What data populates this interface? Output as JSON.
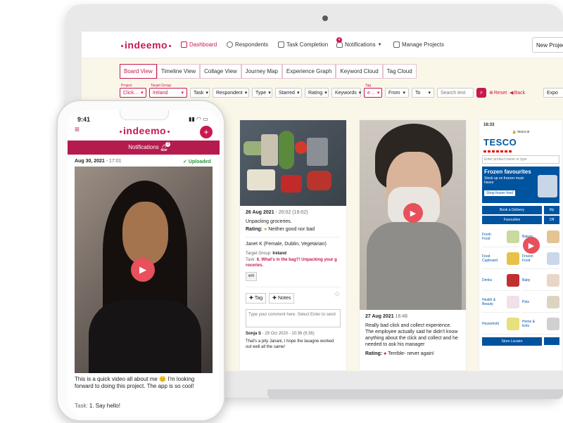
{
  "brand": {
    "name": "indeemo",
    "color": "#c8184f",
    "accent": "#e8505b"
  },
  "nav": {
    "dashboard": "Dashboard",
    "respondents": "Respondents",
    "task_completion": "Task Completion",
    "notifications": "Notifications",
    "notif_count": "4",
    "manage_projects": "Manage Projects",
    "new_project": "New Projec"
  },
  "views": [
    "Board View",
    "Timeline View",
    "Collage View",
    "Journey Map",
    "Experience Graph",
    "Keyword Cloud",
    "Tag Cloud"
  ],
  "filters": {
    "project_label": "Project",
    "project_value": "Click…",
    "target_label": "Target Group",
    "target_value": "Ireland",
    "task": "Task",
    "respondent": "Respondent",
    "type": "Type",
    "starred": "Starred",
    "rating": "Rating",
    "keywords": "Keywords",
    "tag_label": "Tag",
    "tag_value": "e…",
    "from": "From",
    "to": "To",
    "search_placeholder": "Search text",
    "reset": "Reset",
    "back": "Back",
    "export": "Expo"
  },
  "card1": {
    "date": "26 Aug 2021",
    "time": " - 20:02 (19:02)",
    "desc": "Unpacking groceries.",
    "rating_label": "Rating:",
    "rating_value": "Neither good nor bad",
    "person": "Janet K (Female, Dublin, Vegetarian)",
    "target_label": "Target Group:",
    "target_value": "Ireland",
    "task_label": "Task:",
    "task_value": "6. What's in the bag?! Unpacking your g roceries.",
    "chip": "em",
    "tag_btn": "Tag",
    "notes_btn": "Notes",
    "comment_placeholder": "Type your comment here. Select Enter to send",
    "comment_author": "Sonja S",
    "comment_time": " - 29 Oct 2020 - 10:36 (9:36)",
    "comment_text": "That's a pity Janani, I hope the lasagne worked out well all the same!"
  },
  "card2": {
    "date": "27 Aug 2021",
    "time": " 16:48",
    "desc": "Really bad click and collect experience. The employee actually said he didn't know anything about the click and collect and he needed to ask his manager",
    "rating_label": "Rating:",
    "rating_value": "Terrible- never again!"
  },
  "card3": {
    "time": "16:33",
    "url": "tesco.ie",
    "logo": "TESCO",
    "search_placeholder": "Enter product name or type",
    "banner_title": "Frozen favourites",
    "banner_sub": "Stock up on freezer must-haves",
    "banner_btn": "Shop frozen food",
    "btn_delivery": "Book a Delivery",
    "btn_my": "My",
    "btn_favourites": "Favourites",
    "btn_off": "Off",
    "categories": [
      "Fresh Food",
      "Bakery",
      "Food Cupboard",
      "Frozen Food",
      "Drinks",
      "Baby",
      "Health & Beauty",
      "Pets",
      "Household",
      "Home & Ents"
    ],
    "store_locator": "Store Locator"
  },
  "phone": {
    "time": "9:41",
    "header_title": "Notifications",
    "badge": "3",
    "post_date": "Aug 30, 2021",
    "post_time": " - 17:01",
    "status": "Uploaded",
    "caption": "This is a quick video all about me 😊 I'm looking forward to doing this project. The app is so cool!",
    "task_label": "Task:",
    "task_value": "1. Say hello!"
  }
}
